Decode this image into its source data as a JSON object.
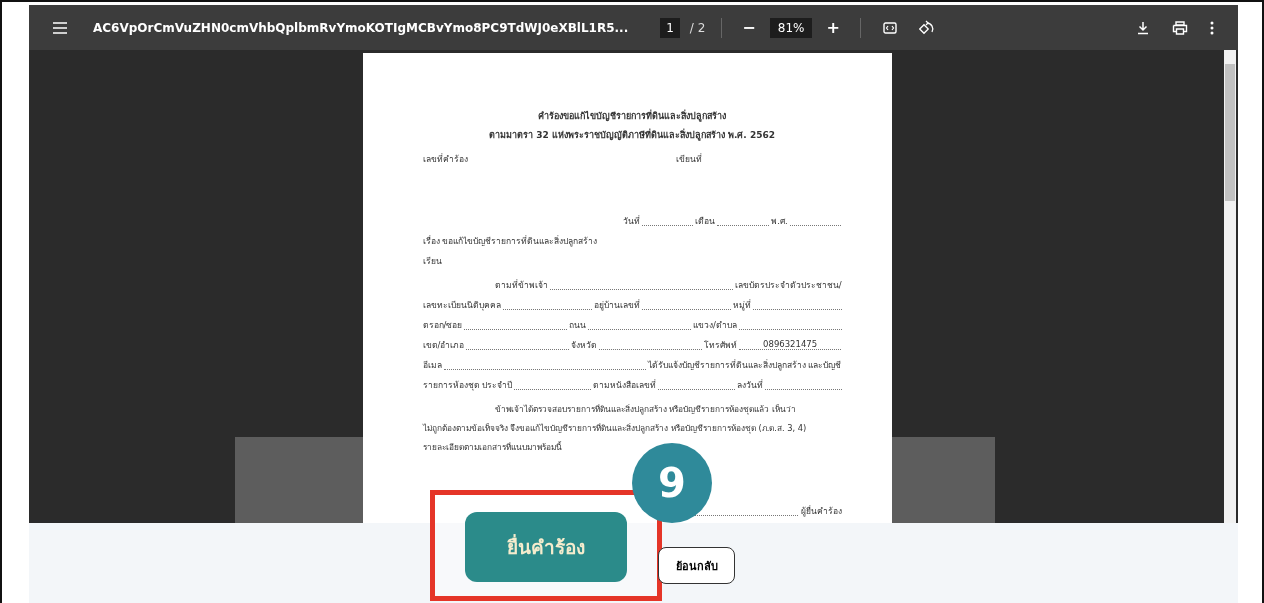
{
  "viewer": {
    "file_name": "AC6VpOrCmVuZHN0cmVhbQplbmRvYmoKOTIgMCBvYmo8PC9TdWJ0eXBlL1R5...",
    "page_input": "1",
    "page_total": "/ 2",
    "zoom_minus": "−",
    "zoom": "81%",
    "zoom_plus": "+"
  },
  "document": {
    "title": "คำร้องขอแก้ไขบัญชีรายการที่ดินและสิ่งปลูกสร้าง",
    "subtitle": "ตามมาตรา 32 แห่งพระราชบัญญัติภาษีที่ดินและสิ่งปลูกสร้าง พ.ศ. 2562",
    "lines": [
      {
        "kind": "split",
        "segments": [
          {
            "kind": "text",
            "text": "เลขที่คำร้อง"
          },
          {
            "kind": "text",
            "text": "เขียนที่"
          }
        ]
      },
      {
        "kind": "date",
        "segments": [
          {
            "kind": "text",
            "text": "วันที่"
          },
          {
            "kind": "blank"
          },
          {
            "kind": "text",
            "text": "เดือน"
          },
          {
            "kind": "blank"
          },
          {
            "kind": "text",
            "text": "พ.ศ."
          },
          {
            "kind": "blank"
          }
        ]
      },
      {
        "kind": "left",
        "segments": [
          {
            "kind": "text",
            "text": "เรื่อง  ขอแก้ไขบัญชีรายการที่ดินและสิ่งปลูกสร้าง"
          }
        ]
      },
      {
        "kind": "left",
        "segments": [
          {
            "kind": "text",
            "text": "เรียน"
          }
        ]
      },
      {
        "kind": "indent",
        "segments": [
          {
            "kind": "text",
            "text": "ตามที่ข้าพเจ้า"
          },
          {
            "kind": "blank"
          },
          {
            "kind": "text",
            "text": "เลขบัตรประจำตัวประชาชน/"
          }
        ]
      },
      {
        "kind": "full",
        "segments": [
          {
            "kind": "text",
            "text": "เลขทะเบียนนิติบุคคล"
          },
          {
            "kind": "blank"
          },
          {
            "kind": "text",
            "text": "อยู่บ้านเลขที่"
          },
          {
            "kind": "blank"
          },
          {
            "kind": "text",
            "text": "หมู่ที่"
          },
          {
            "kind": "blank"
          }
        ]
      },
      {
        "kind": "full",
        "segments": [
          {
            "kind": "text",
            "text": "ตรอก/ซอย"
          },
          {
            "kind": "blank"
          },
          {
            "kind": "text",
            "text": "ถนน"
          },
          {
            "kind": "blank"
          },
          {
            "kind": "text",
            "text": "แขวง/ตำบล"
          },
          {
            "kind": "blank"
          }
        ]
      },
      {
        "kind": "full",
        "segments": [
          {
            "kind": "text",
            "text": "เขต/อำเภอ"
          },
          {
            "kind": "blank"
          },
          {
            "kind": "text",
            "text": "จังหวัด"
          },
          {
            "kind": "blank"
          },
          {
            "kind": "text",
            "text": "โทรศัพท์"
          },
          {
            "kind": "blank",
            "value": "0896321475"
          }
        ]
      },
      {
        "kind": "full",
        "segments": [
          {
            "kind": "text",
            "text": "อีเมล"
          },
          {
            "kind": "blank"
          },
          {
            "kind": "text",
            "text": "ได้รับแจ้งบัญชีรายการที่ดินและสิ่งปลูกสร้าง และบัญชี"
          }
        ]
      },
      {
        "kind": "full",
        "segments": [
          {
            "kind": "text",
            "text": "รายการห้องชุด ประจำปี"
          },
          {
            "kind": "blank"
          },
          {
            "kind": "text",
            "text": "ตามหนังสือเลขที่"
          },
          {
            "kind": "blank"
          },
          {
            "kind": "text",
            "text": "ลงวันที่"
          },
          {
            "kind": "blank"
          }
        ]
      }
    ],
    "paragraph": [
      "ข้าพเจ้าได้ตรวจสอบรายการที่ดินและสิ่งปลูกสร้าง หรือบัญชีรายการห้องชุดแล้ว เห็นว่า",
      "ไม่ถูกต้องตามข้อเท็จจริง จึงขอแก้ไขบัญชีรายการที่ดินและสิ่งปลูกสร้าง หรือบัญชีรายการห้องชุด (ภ.ด.ส. 3, 4)",
      "รายละเอียดตามเอกสารที่แนบมาพร้อมนี้"
    ],
    "signature": "ผู้ยื่นคำร้อง"
  },
  "actions": [
    {
      "kind": "primary",
      "label": "ยื่นคำร้อง",
      "highlighted": true
    },
    {
      "kind": "secondary",
      "label": "ย้อนกลับ",
      "highlighted": false
    }
  ],
  "step_badge": "9"
}
